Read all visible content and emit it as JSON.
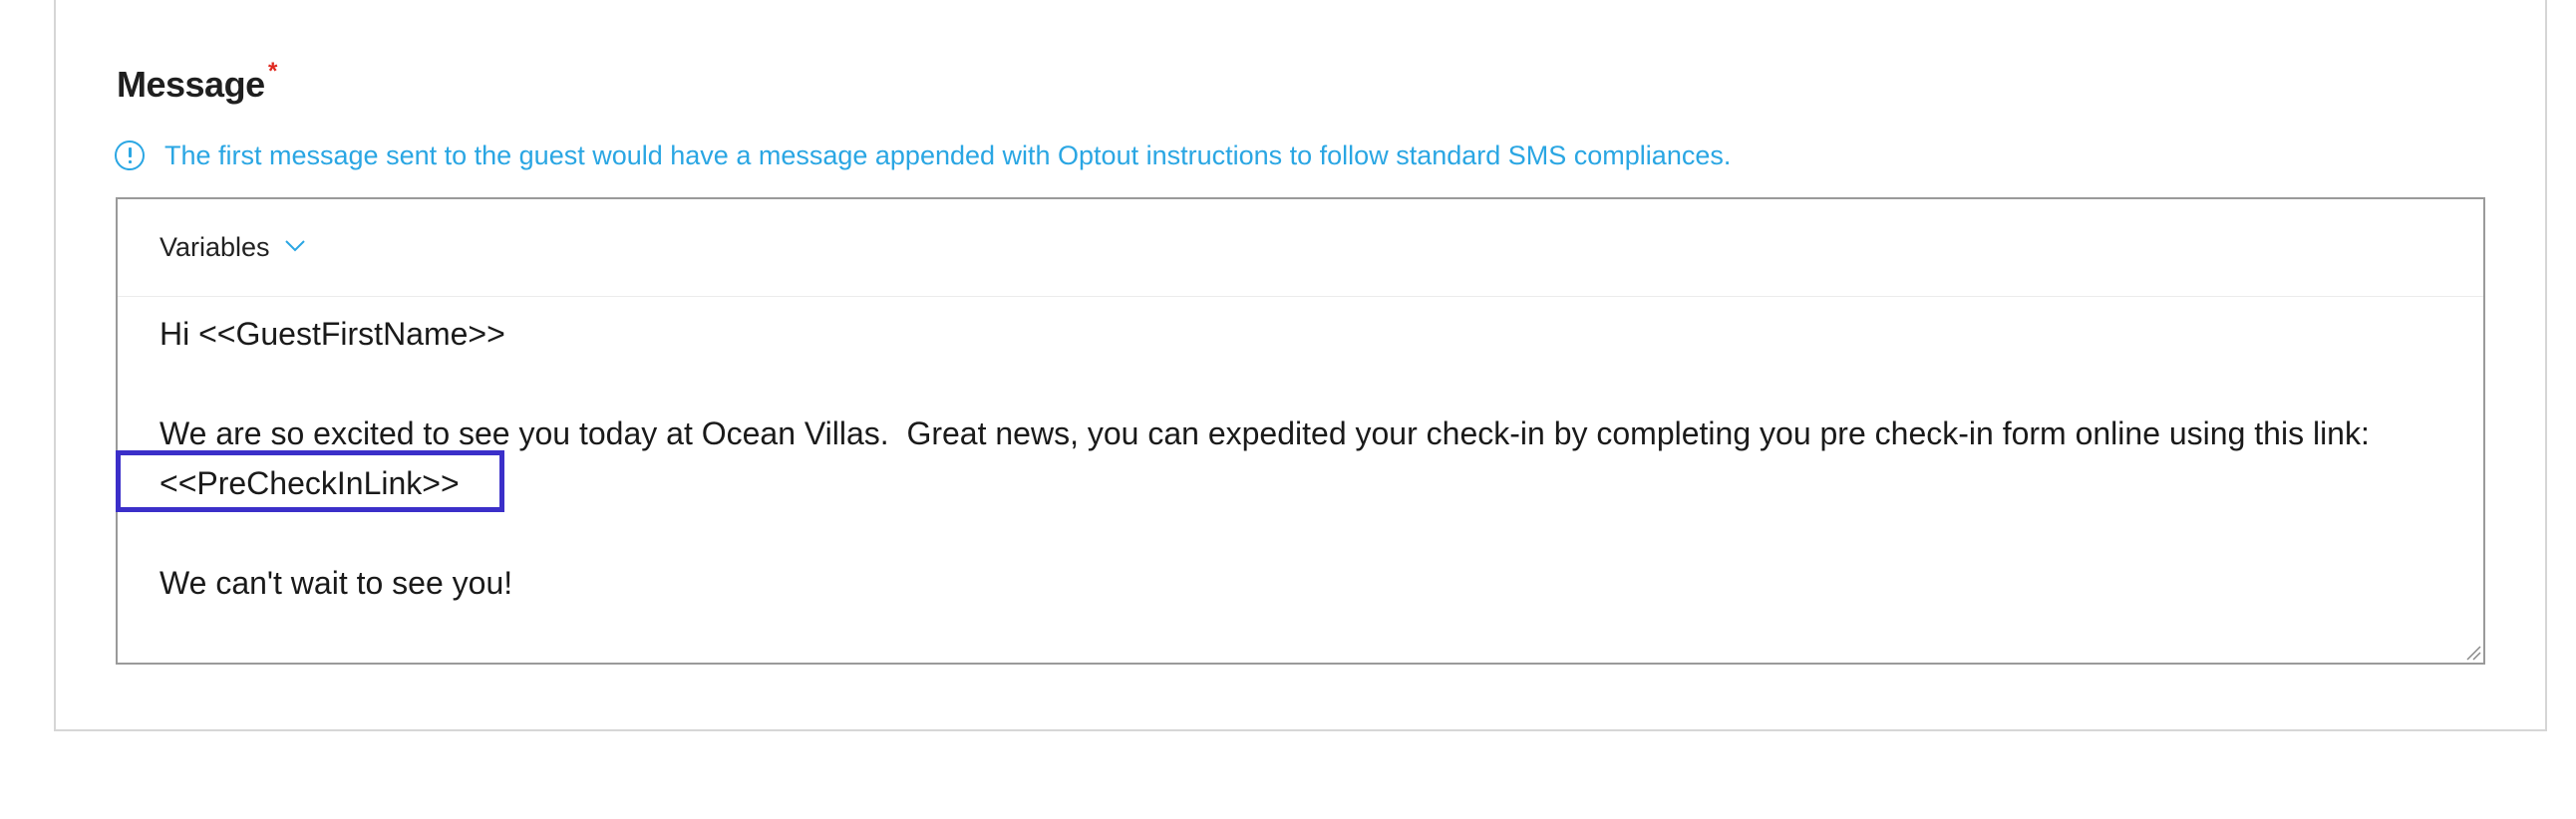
{
  "message_section": {
    "title": "Message",
    "required_mark": "*",
    "info_text": "The first message sent to the guest would have a message appended with Optout instructions to follow standard SMS compliances.",
    "info_icon": "info-circle-icon",
    "colors": {
      "info": "#2aa6e3",
      "required": "#e0281f",
      "highlight": "#3b2fc9"
    }
  },
  "editor": {
    "variables_label": "Variables",
    "variables_icon": "chevron-down-icon",
    "lines": [
      "Hi <<GuestFirstName>>",
      "",
      "We are so excited to see you today at Ocean Villas.  Great news, you can expedited your check-in by completing you pre check-in form online using this link:",
      "<<PreCheckInLink>>",
      "",
      "We can't wait to see you!"
    ]
  }
}
